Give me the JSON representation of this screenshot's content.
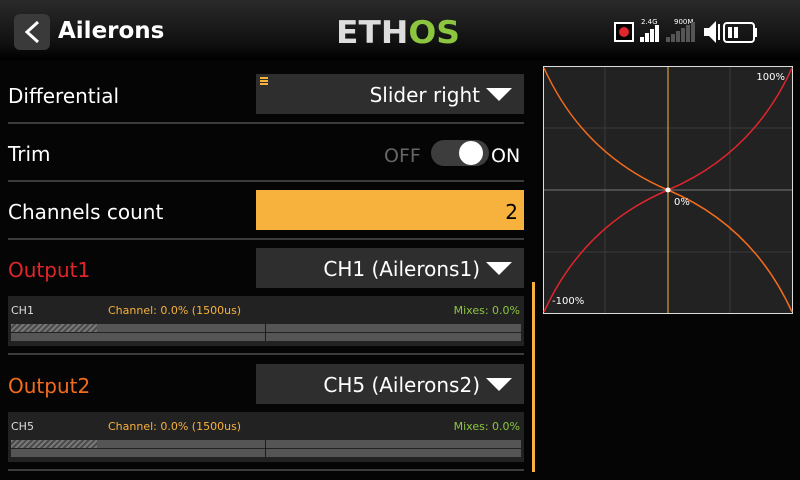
{
  "header": {
    "title": "Ailerons",
    "logo_text": "ETHOS",
    "status": {
      "rx_24": "2.4G",
      "rx_900": "900M"
    }
  },
  "rows": {
    "differential": {
      "label": "Differential",
      "value": "Slider right"
    },
    "trim": {
      "label": "Trim",
      "off_label": "OFF",
      "on_label": "ON",
      "state": "on"
    },
    "channels_count": {
      "label": "Channels count",
      "value": "2"
    },
    "output1": {
      "label": "Output1",
      "label_color": "#e0252c",
      "value": "CH1 (Ailerons1)",
      "monitor": {
        "channel": "CH1",
        "channel_value": "Channel: 0.0% (1500us)",
        "mixes": "Mixes: 0.0%"
      }
    },
    "output2": {
      "label": "Output2",
      "label_color": "#f26c1d",
      "value": "CH5 (Ailerons2)",
      "monitor": {
        "channel": "CH5",
        "channel_value": "Channel: 0.0% (1500us)",
        "mixes": "Mixes: 0.0%"
      }
    }
  },
  "curve": {
    "top_label": "100%",
    "center_label": "0%",
    "bottom_label": "-100%"
  },
  "colors": {
    "accent": "#f7b13d",
    "logo_green": "#8cc63f",
    "output1_curve": "#e0252c",
    "output2_curve": "#f26c1d"
  },
  "icons": [
    "back-arrow-icon",
    "record-icon",
    "signal-24-icon",
    "signal-900-icon",
    "speaker-icon",
    "battery-icon",
    "menu-icon",
    "dropdown-arrow-icon"
  ]
}
